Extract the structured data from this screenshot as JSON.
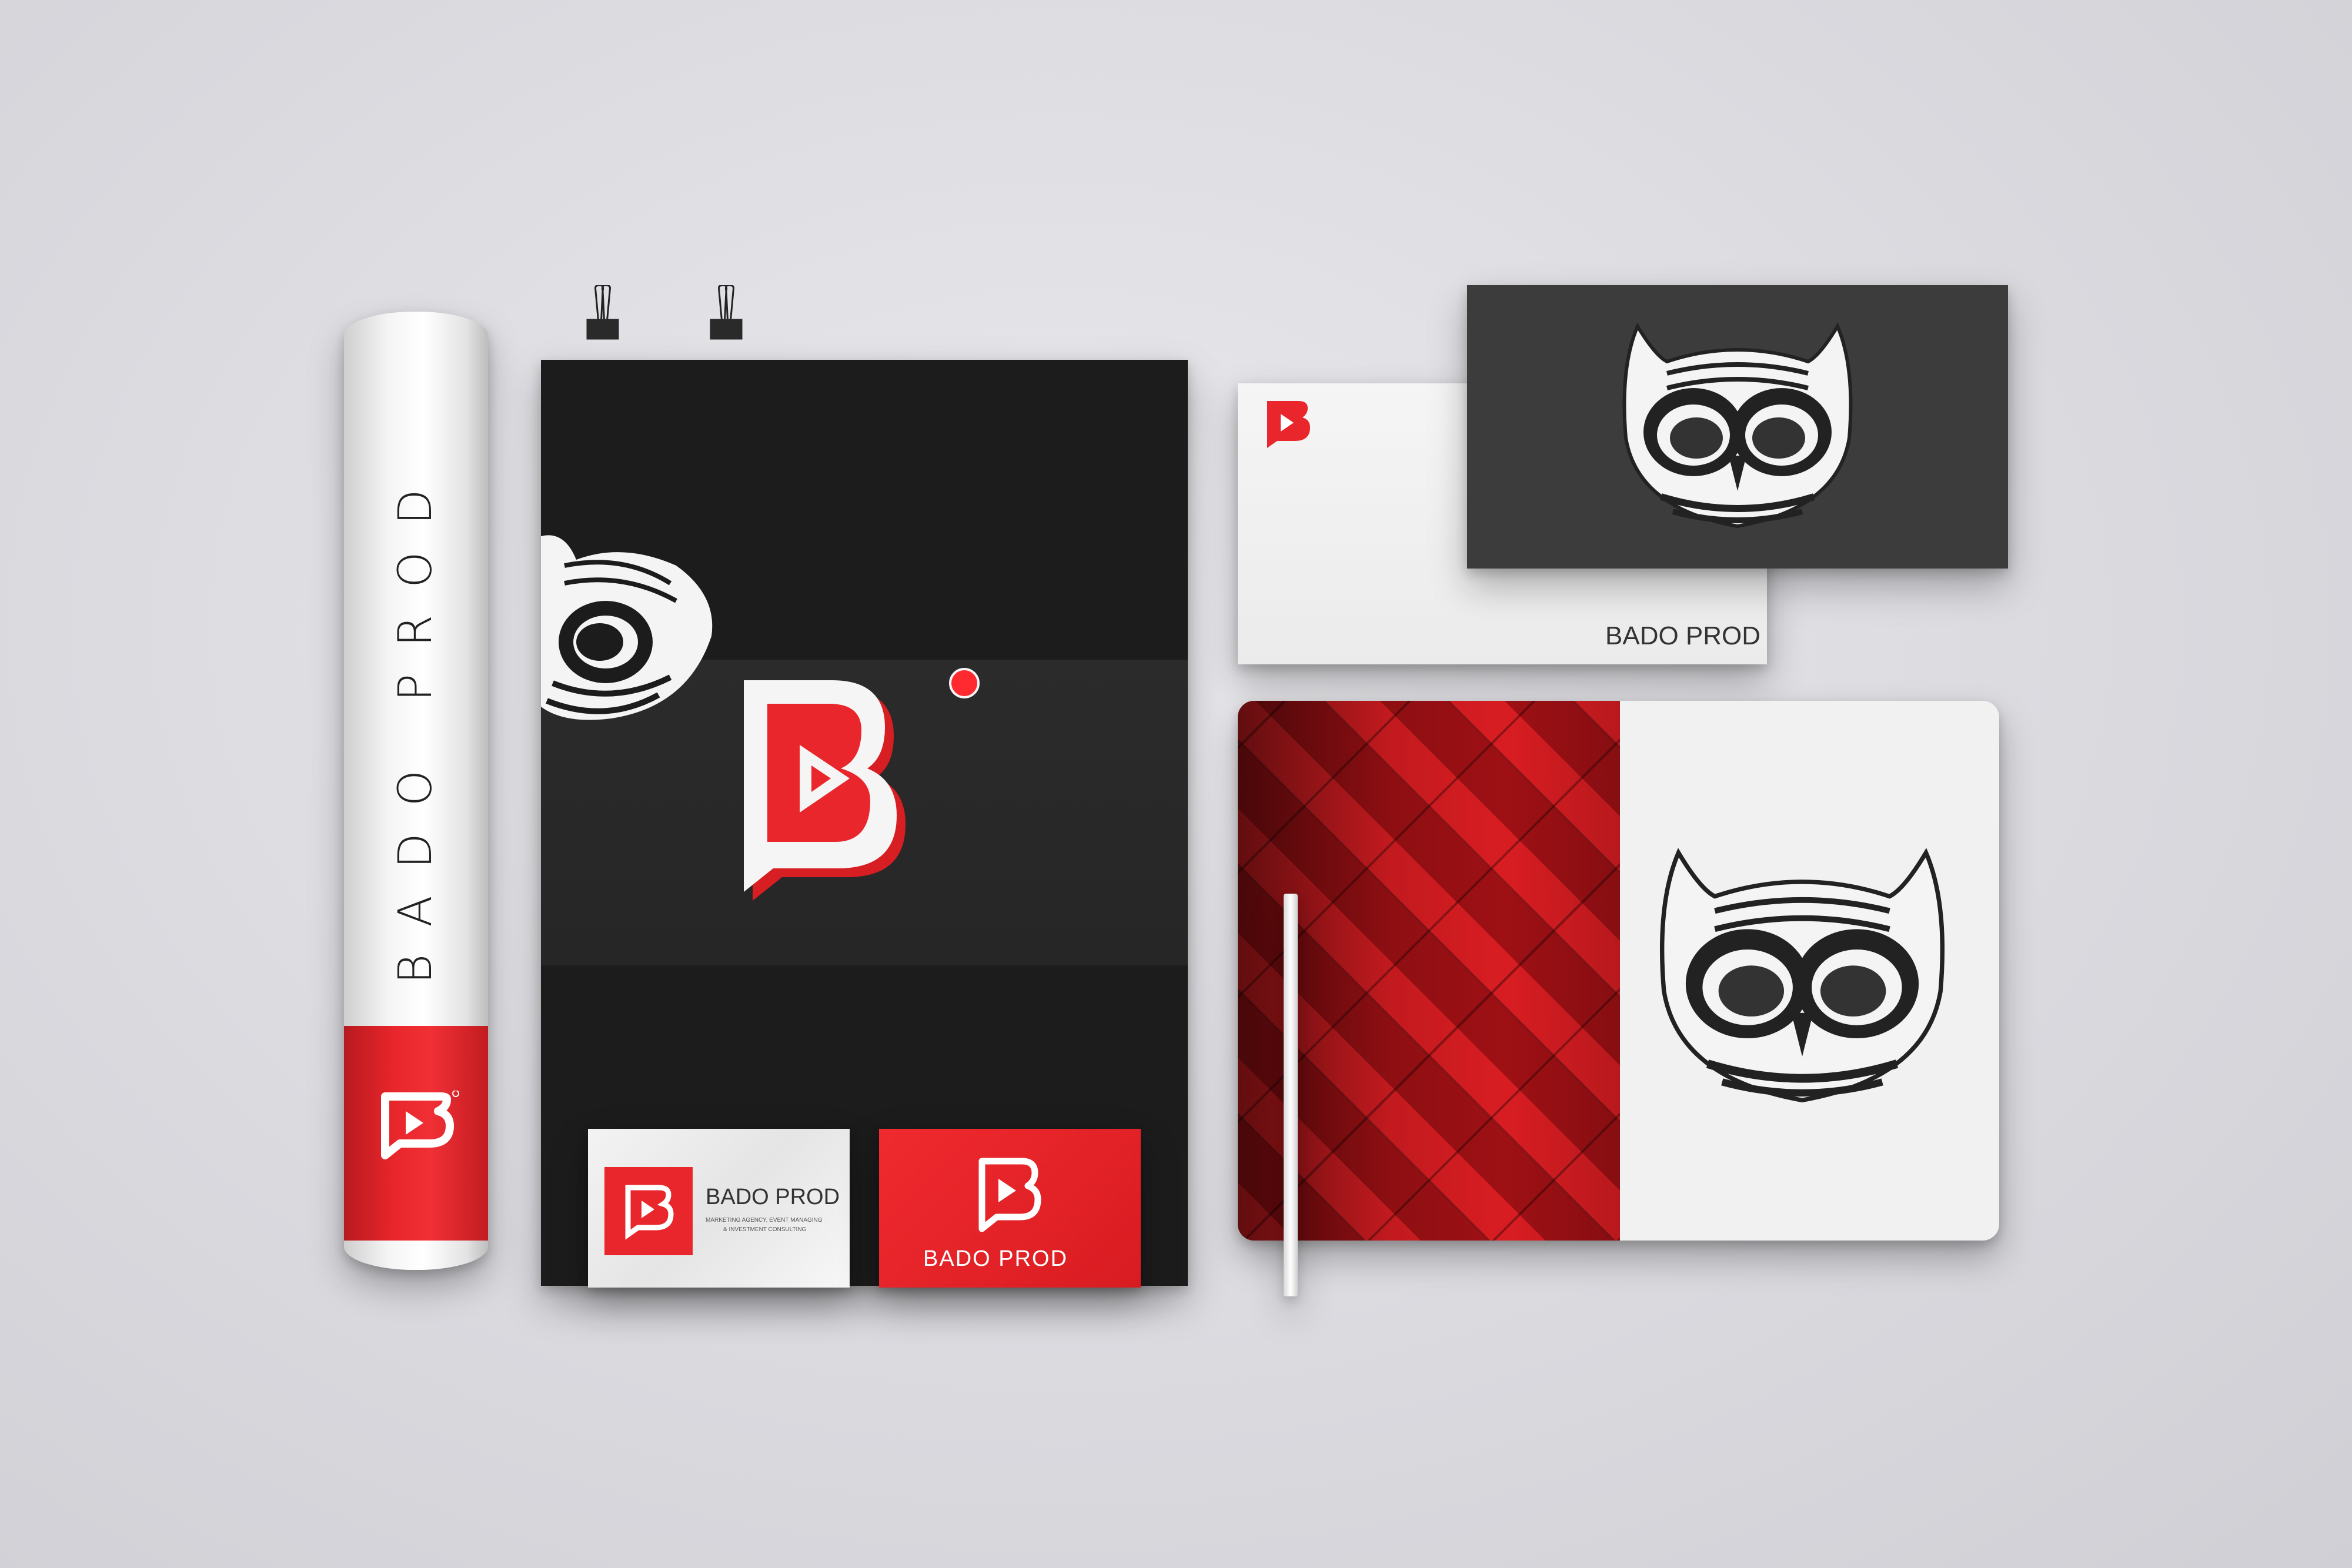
{
  "brand": {
    "name": "BADO PROD",
    "tagline_line1": "MARKETING AGENCY, EVENT MANAGING",
    "tagline_line2": "& INVESTMENT CONSULTING"
  },
  "tube": {
    "text": "BADO PROD"
  },
  "card_white": {
    "name": "BADO PROD"
  },
  "card_red": {
    "name": "BADO PROD"
  },
  "envelope": {
    "name": "BADO PROD"
  },
  "colors": {
    "red": "#e8262b",
    "dark": "#1c1c1c",
    "charcoal": "#3c3c3c",
    "paper": "#f3f3f3"
  },
  "icons": [
    "b-play-logo-icon",
    "owl-icon",
    "binder-clip-icon",
    "pencil-icon"
  ]
}
